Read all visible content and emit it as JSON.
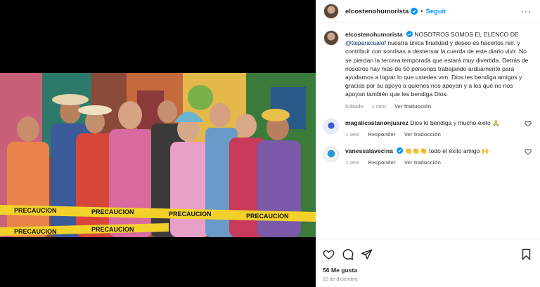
{
  "post": {
    "username": "elcostenohumorista",
    "follow_label": "Seguir",
    "more_label": "···",
    "separator": "•"
  },
  "caption": {
    "username": "elcostenohumorista",
    "text_before_mention": "NOSOTROS SOMOS EL ELENCO DE",
    "mention": "@taiparacualof",
    "text_after_mention": "nuestra única finalidad y deseo es hacerlos reir. y contribuir con sonrisas a destensar la cuerda de este diario vivir. No se pierdan la tercera temporada que estará muy divertida. Detrás de nosotros hay más de 50 personas trabajando arduamente para ayudarnos a lograr lo que ustedes ven. Dios les bendiga amigos y gracias por su apoyo a quienes nos apoyan y a los que no nos apoyan también que les bendiga Dios.",
    "edited_label": "Editado",
    "time": "1 sem",
    "translate_label": "Ver traducción"
  },
  "comments": [
    {
      "username": "magalicastanonjuarez",
      "text": "Dios lo bendiga y mucho éxito 🙏",
      "time": "1 sem",
      "reply_label": "Responder",
      "translate_label": "Ver traducción"
    },
    {
      "username": "vanessalavecina",
      "text": "👏👏👏 todo el éxito amigo 🙌",
      "time": "1 sem",
      "reply_label": "Responder",
      "translate_label": "Ver traducción"
    }
  ],
  "engagement": {
    "likes": "56 Me gusta",
    "date": "10 de diciembre"
  },
  "photo": {
    "tape_text": "PRECAUCION"
  },
  "colors": {
    "accent": "#0095f6",
    "verified": "#0095f6",
    "meta": "#8e8e8e",
    "mention": "#00376b"
  },
  "icons": {
    "like": "heart-icon",
    "comment": "comment-icon",
    "share": "share-icon",
    "save": "bookmark-icon"
  }
}
